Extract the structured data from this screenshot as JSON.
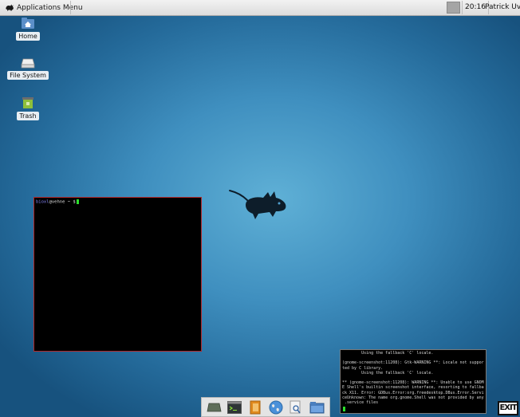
{
  "panel": {
    "app_menu_label": "Applications Menu",
    "clock": "20:16",
    "user": "Patrick Uven"
  },
  "desktop_icons": [
    {
      "label": "Home",
      "icon": "home-folder-icon"
    },
    {
      "label": "File System",
      "icon": "drive-icon"
    },
    {
      "label": "Trash",
      "icon": "trash-icon"
    }
  ],
  "terminal_small": {
    "user": "bioxl",
    "host_path": "@vehne ~ $"
  },
  "terminal_log": {
    "text": "        Using the fallback 'C' locale.\n\n(gnome-screenshot:11208): Gtk-WARNING **: Locale not suppor\nted by C library.\n        Using the fallback 'C' locale.\n\n** (gnome-screenshot:11208): WARNING **: Unable to use GNOM\nE Shell's builtin screenshot interface, resorting to fallba\nck X11. Error: GDBus.Error:org.freedesktop.DBus.Error.Servi\nceUnknown: The name org.gnome.Shell was not provided by any\n .service files"
  },
  "dock_items": [
    "show-desktop-icon",
    "terminal-icon",
    "text-editor-icon",
    "web-browser-icon",
    "search-icon",
    "file-manager-icon"
  ],
  "exit_label": "EXIT"
}
